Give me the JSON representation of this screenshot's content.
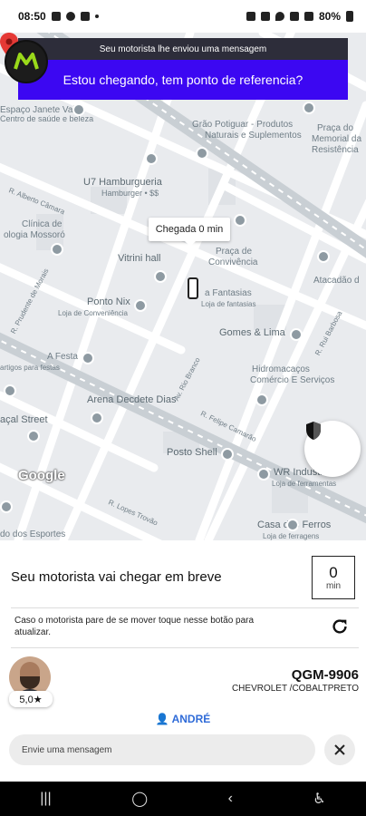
{
  "status_bar": {
    "time": "08:50",
    "battery": "80%"
  },
  "notification": {
    "title": "Seu motorista lhe enviou uma mensagem",
    "message": "Estou chegando, tem ponto de referencia?"
  },
  "map": {
    "tooltip": "Chegada  0 min",
    "labels": {
      "l1": "Espaço Janete Vale",
      "l2": "Centro de saúde e beleza",
      "l3": "Grão Potiguar - Produtos",
      "l4": "Naturais e Suplementos",
      "l5": "Praça do",
      "l6": "Memorial da",
      "l7": "Resistência",
      "l8": "U7 Hamburgueria",
      "l9": "Hamburger • $$",
      "l10": "R. Alberto Câmara",
      "l11": "Clínica de",
      "l12": "ologia Mossoró",
      "l13": "Vitrini hall",
      "l14": "Praça de",
      "l15": "Convivência",
      "l16": "Atacadão d",
      "l17": "Ponto Nix",
      "l18": "Loja de Conveniência",
      "l19": "a Fantasias",
      "l20": "Loja de fantasias",
      "l21": "Gomes & Lima",
      "l22": "R. Prudente de Morais",
      "l23": "A Festa",
      "l24": "artigos para festas",
      "l25": "Hidromacaços",
      "l26": "Comércio E Serviços",
      "l27": "Arena Decdete Dias",
      "l28": "açal Street",
      "l29": "Posto Shell",
      "l30": "WR Industrial",
      "l31": "Loja de ferramentas",
      "l32": "Casa dos Ferros",
      "l33": "Loja de ferragens",
      "l34": "do dos Esportes",
      "l35": "R. Lopes Trovão",
      "l36": "Av. Rio Branco",
      "l37": "R. Felipe Camarão",
      "l38": "R. Rui Barbosa",
      "google": "Google"
    }
  },
  "sheet": {
    "arrival_text": "Seu motorista vai chegar em breve",
    "eta_value": "0",
    "eta_unit": "min",
    "hint": "Caso o motorista pare de se mover toque nesse botão para atualizar.",
    "rating": "5,0★",
    "plate": "QGM-9906",
    "model": "CHEVROLET /COBALTPRETO",
    "driver_name": "ANDRÉ",
    "message_placeholder": "Envie uma mensagem"
  },
  "colors": {
    "notification_bg": "#3c07f2",
    "link_blue": "#2f6bd8",
    "pin_red": "#e53935"
  }
}
